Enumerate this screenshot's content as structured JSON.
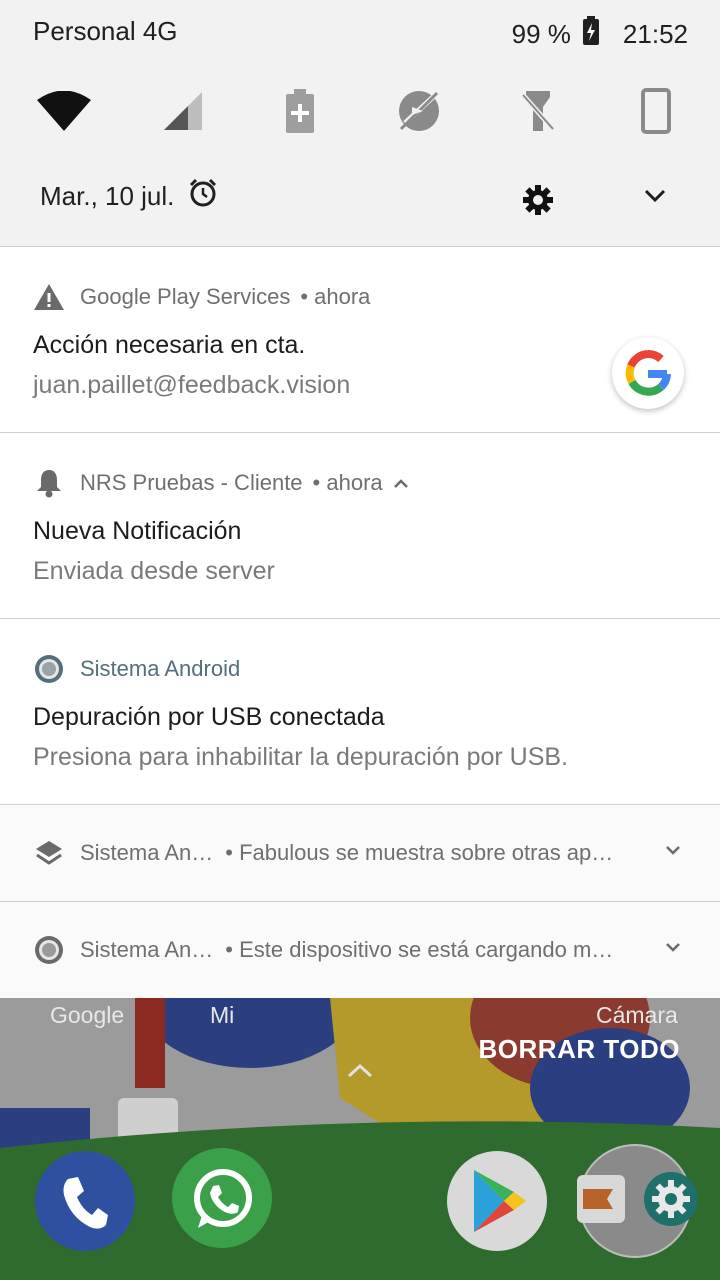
{
  "status_bar": {
    "carrier": "Personal 4G",
    "battery_percent": "99 %",
    "time": "21:52"
  },
  "quick_settings": [
    {
      "name": "wifi-icon"
    },
    {
      "name": "signal-icon"
    },
    {
      "name": "battery-saver-icon"
    },
    {
      "name": "location-off-icon"
    },
    {
      "name": "flashlight-off-icon"
    },
    {
      "name": "rotation-icon"
    }
  ],
  "header": {
    "date": "Mar., 10 jul."
  },
  "notifications": [
    {
      "app": "Google Play Services",
      "time": "• ahora",
      "title": "Acción necesaria en cta.",
      "text": "juan.paillet@feedback.vision"
    },
    {
      "app": "NRS Pruebas - Cliente",
      "time": "• ahora",
      "title": "Nueva Notificación",
      "text": "Enviada desde server"
    },
    {
      "app": "Sistema Android",
      "title": "Depuración por USB conectada",
      "text": "Presiona para inhabilitar la depuración por USB."
    }
  ],
  "collapsed": [
    {
      "app": "Sistema An…",
      "text": "• Fabulous se muestra sobre otras ap…"
    },
    {
      "app": "Sistema An…",
      "text": "• Este dispositivo se está cargando m…"
    }
  ],
  "home": {
    "labels": [
      "Google",
      "Mi",
      "Cámara"
    ],
    "clear_all": "BORRAR TODO"
  },
  "colors": {
    "shade": "#f2f2f2",
    "accent_android": "#546e7a",
    "text_primary": "#1c1c1c",
    "text_secondary": "#7a7a7a"
  }
}
